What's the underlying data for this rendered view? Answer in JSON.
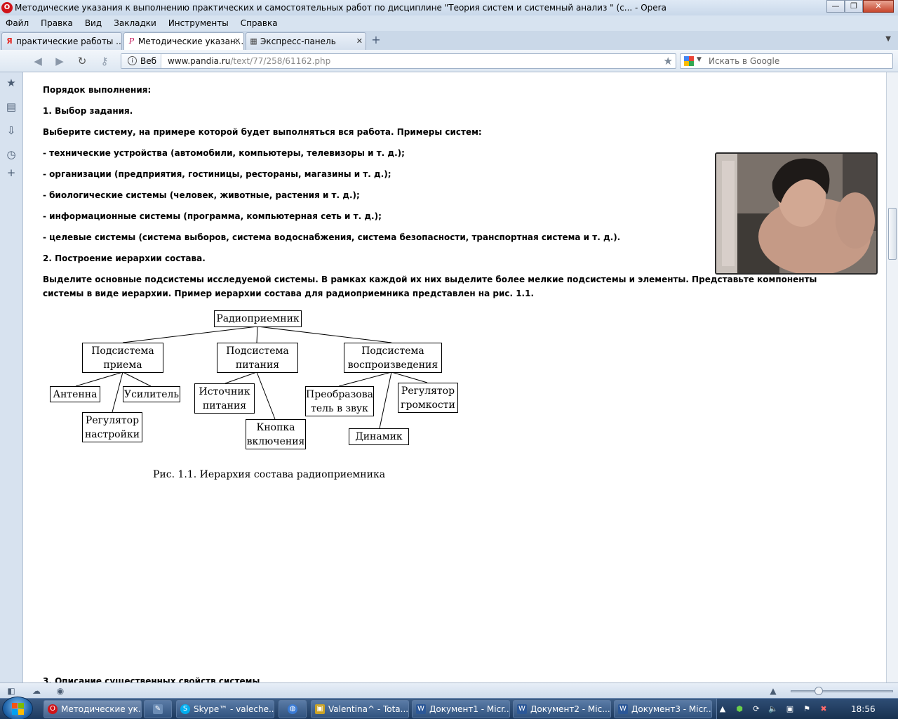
{
  "window": {
    "title": "Методические указания к выполнению практических и самостоятельных работ по дисциплине \"Теория систем и системный анализ \" (с... - Opera",
    "minimize": "—",
    "maximize": "❐",
    "close": "✕"
  },
  "menu": [
    "Файл",
    "Правка",
    "Вид",
    "Закладки",
    "Инструменты",
    "Справка"
  ],
  "tabs": [
    {
      "label": "практические работы ...",
      "icon": "Я"
    },
    {
      "label": "Методические указан...",
      "icon": "P"
    },
    {
      "label": "Экспресс-панель",
      "icon": "▦"
    }
  ],
  "address": {
    "badge": "Веб",
    "url_host": "www.pandia.ru",
    "url_path": "/text/77/258/61162.php"
  },
  "search": {
    "placeholder": "Искать в Google"
  },
  "content": {
    "p1": "Порядок выполнения:",
    "p2": "1.  Выбор задания.",
    "p3": "Выберите систему, на примере которой будет выполняться вся работа. Примеры систем:",
    "p4": "- технические устройства (автомобили, компьютеры, телевизоры и т. д.);",
    "p5": "- организации (предприятия, гостиницы, рестораны, магазины и т. д.);",
    "p6": "- биологические системы (человек, животные, растения и т. д.);",
    "p7": "- информационные системы (программа, компьютерная сеть и т. д.);",
    "p8": "- целевые системы (система выборов, система водоснабжения, система безопасности, транспортная система и т. д.).",
    "p9": "2. Построение иерархии состава.",
    "p10": "Выделите основные подсистемы исследуемой системы. В рамках каждой их них выделите более мелкие подсистемы и элементы. Представьте компоненты системы в виде иерархии. Пример иерархии состава для радиоприемника представлен на рис. 1.1.",
    "p11": "3. Описание существенных свойств системы"
  },
  "diagram": {
    "root": "Радиоприемник",
    "sub_reception": "Подсистема приема",
    "sub_power": "Подсистема питания",
    "sub_playback": "Подсистема воспроизведения",
    "antenna": "Антенна",
    "amplifier": "Усилитель",
    "tuning": "Регулятор настройки",
    "power_source": "Источник питания",
    "power_button": "Кнопка включения",
    "converter": "Преобразова тель в звук",
    "volume": "Регулятор громкости",
    "speaker": "Динамик",
    "caption": "Рис. 1.1. Иерархия состава радиоприемника"
  },
  "taskbar": {
    "items": [
      {
        "label": "Методические ук...",
        "icon": "O",
        "color": "#d0141a"
      },
      {
        "label": "",
        "icon": "✎",
        "color": "#6b8cb5"
      },
      {
        "label": "Skype™ - valeche...",
        "icon": "S",
        "color": "#00aff0"
      },
      {
        "label": "",
        "icon": "◍",
        "color": "#3a7bd5"
      },
      {
        "label": "Valentina^ - Tota...",
        "icon": "▣",
        "color": "#c9a227"
      },
      {
        "label": "Документ1 - Micr...",
        "icon": "W",
        "color": "#2b5797"
      },
      {
        "label": "Документ2 - Mic...",
        "icon": "W",
        "color": "#2b5797"
      },
      {
        "label": "Документ3 - Micr...",
        "icon": "W",
        "color": "#2b5797"
      }
    ],
    "clock": "18:56"
  }
}
